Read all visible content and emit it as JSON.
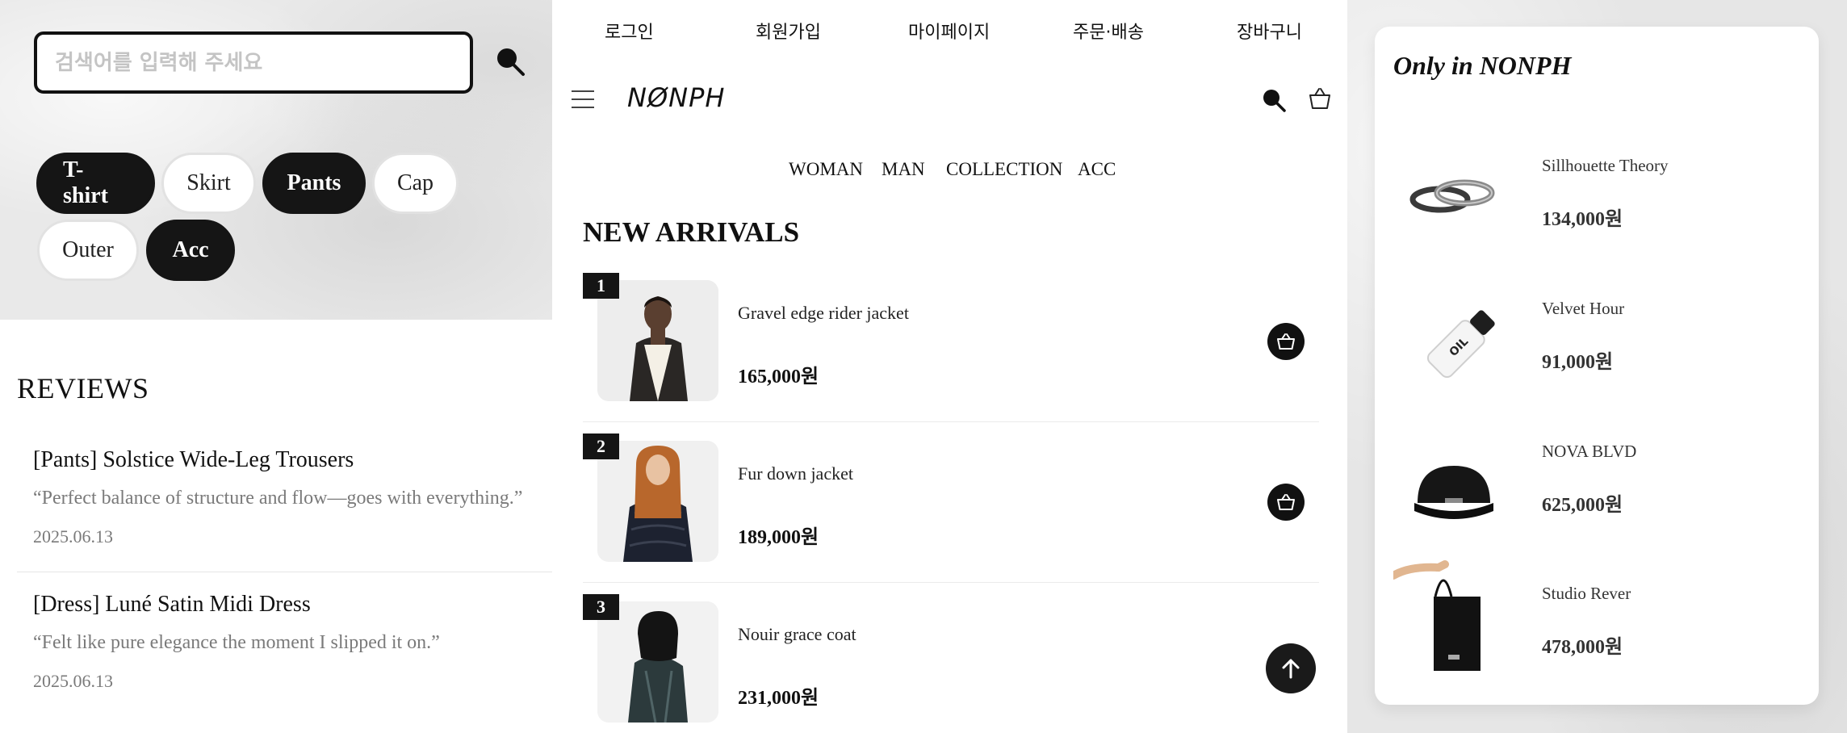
{
  "search": {
    "placeholder": "검색어를 입력해 주세요"
  },
  "categories": [
    {
      "label": "T-shirt",
      "active": true
    },
    {
      "label": "Skirt",
      "active": false
    },
    {
      "label": "Pants",
      "active": true
    },
    {
      "label": "Cap",
      "active": false
    },
    {
      "label": "Outer",
      "active": false
    },
    {
      "label": "Acc",
      "active": true
    }
  ],
  "reviews": {
    "title": "REVIEWS",
    "items": [
      {
        "title": "[Pants] Solstice Wide-Leg Trousers",
        "quote": "“Perfect balance of structure and flow—goes with everything.”",
        "date": "2025.06.13"
      },
      {
        "title": "[Dress] Luné Satin Midi Dress",
        "quote": "“Felt like pure elegance the moment I slipped it on.”",
        "date": "2025.06.13"
      }
    ]
  },
  "header": {
    "top_links": [
      "로그인",
      "회원가입",
      "마이페이지",
      "주문·배송",
      "장바구니"
    ],
    "logo": "NØNPH",
    "nav": [
      "WOMAN",
      "MAN",
      "COLLECTION",
      "ACC"
    ]
  },
  "new_arrivals": {
    "title": "NEW ARRIVALS",
    "items": [
      {
        "rank": "1",
        "name": "Gravel edge rider jacket",
        "price": "165,000원"
      },
      {
        "rank": "2",
        "name": "Fur down jacket",
        "price": "189,000원"
      },
      {
        "rank": "3",
        "name": "Nouir grace coat",
        "price": "231,000원"
      }
    ]
  },
  "exclusive": {
    "title": "Only in NONPH",
    "items": [
      {
        "name": "Sillhouette Theory",
        "price": "134,000원",
        "icon": "rings"
      },
      {
        "name": "Velvet Hour",
        "price": "91,000원",
        "icon": "oil-bottle"
      },
      {
        "name": "NOVA BLVD",
        "price": "625,000원",
        "icon": "cap"
      },
      {
        "name": "Studio Rever",
        "price": "478,000원",
        "icon": "tote-bag"
      }
    ],
    "bottle_label": "OIL"
  },
  "colors": {
    "accent": "#151515",
    "muted": "#7a7a7a",
    "panel_bg": "#e9e9e9"
  }
}
